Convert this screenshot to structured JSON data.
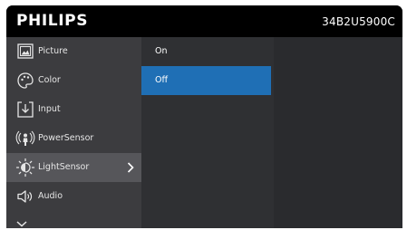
{
  "header": {
    "brand": "PHILIPS",
    "model": "34B2U5900C"
  },
  "menu": {
    "items": [
      {
        "label": "Picture",
        "icon": "picture-icon"
      },
      {
        "label": "Color",
        "icon": "palette-icon"
      },
      {
        "label": "Input",
        "icon": "input-icon"
      },
      {
        "label": "PowerSensor",
        "icon": "power-sensor-icon"
      },
      {
        "label": "LightSensor",
        "icon": "light-sensor-icon",
        "selected": true
      },
      {
        "label": "Audio",
        "icon": "speaker-icon"
      }
    ],
    "more_icon": "chevron-down-icon"
  },
  "submenu": {
    "options": [
      {
        "label": "On"
      },
      {
        "label": "Off",
        "selected": true
      }
    ]
  },
  "colors": {
    "header_bg": "#000000",
    "menu_bg": "#3c3c3f",
    "menu_selected_bg": "#56565a",
    "submenu_bg": "#2f3033",
    "option_selected_bg": "#1f6fb5",
    "panel_bg": "#2a2b2e"
  }
}
